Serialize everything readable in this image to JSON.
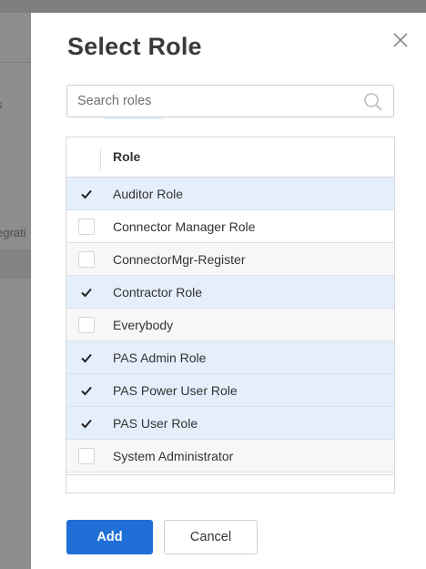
{
  "background": {
    "fragment_1": "s",
    "fragment_2": "egrati"
  },
  "dialog": {
    "title": "Select Role",
    "close_icon": "close-icon",
    "search": {
      "placeholder": "Search roles",
      "value": "",
      "icon": "search-icon"
    },
    "grid": {
      "column_header": "Role",
      "rows": [
        {
          "label": "Auditor Role",
          "checked": true
        },
        {
          "label": "Connector Manager Role",
          "checked": false
        },
        {
          "label": "ConnectorMgr-Register",
          "checked": false
        },
        {
          "label": "Contractor Role",
          "checked": true
        },
        {
          "label": "Everybody",
          "checked": false
        },
        {
          "label": "PAS Admin Role",
          "checked": true
        },
        {
          "label": "PAS Power User Role",
          "checked": true
        },
        {
          "label": "PAS User Role",
          "checked": true
        },
        {
          "label": "System Administrator",
          "checked": false
        }
      ]
    },
    "buttons": {
      "add_label": "Add",
      "cancel_label": "Cancel"
    }
  },
  "colors": {
    "primary": "#1f6fd6",
    "selected_row": "#e5eefb",
    "overlay": "#8d8d8d"
  }
}
